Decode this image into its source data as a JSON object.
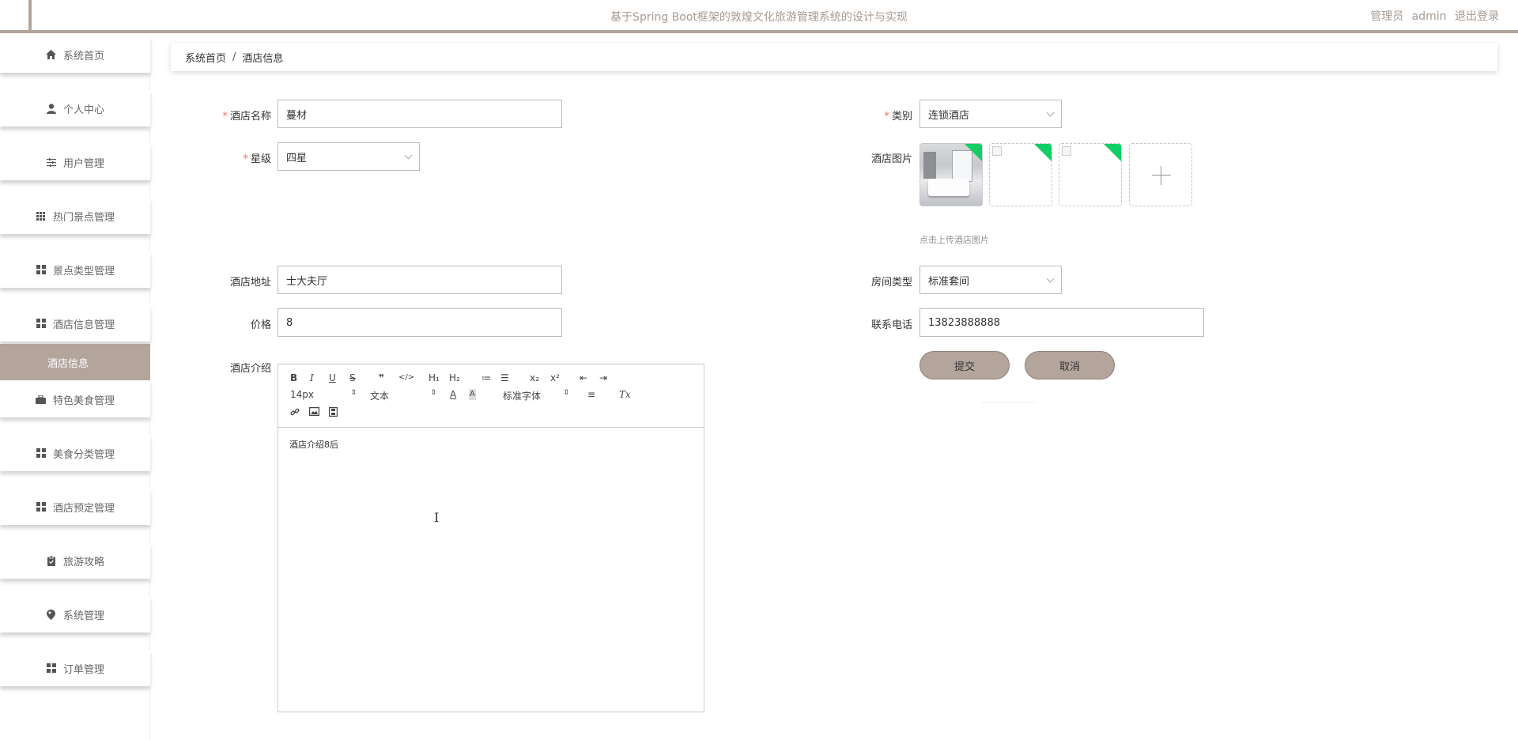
{
  "header": {
    "title": "基于Spring Boot框架的敦煌文化旅游管理系统的设计与实现",
    "role": "管理员",
    "username": "admin",
    "logout_label": "退出登录"
  },
  "sidebar": {
    "items": [
      {
        "label": "系统首页",
        "icon": "home-icon"
      },
      {
        "label": "个人中心",
        "icon": "user-icon"
      },
      {
        "label": "用户管理",
        "icon": "sliders-icon"
      },
      {
        "label": "热门景点管理",
        "icon": "grid-icon"
      },
      {
        "label": "景点类型管理",
        "icon": "apps-icon"
      },
      {
        "label": "酒店信息管理",
        "icon": "apps-icon"
      },
      {
        "label": "酒店信息",
        "active": true
      },
      {
        "label": "特色美食管理",
        "icon": "briefcase-icon"
      },
      {
        "label": "美食分类管理",
        "icon": "apps-icon"
      },
      {
        "label": "酒店预定管理",
        "icon": "apps-icon"
      },
      {
        "label": "旅游攻略",
        "icon": "clipboard-icon"
      },
      {
        "label": "系统管理",
        "icon": "location-icon"
      },
      {
        "label": "订单管理",
        "icon": "apps-icon"
      }
    ],
    "active_color": "#b3a59c"
  },
  "breadcrumb": {
    "home": "系统首页",
    "separator": "/",
    "current": "酒店信息"
  },
  "form": {
    "name": {
      "label": "酒店名称",
      "value": "蔓材"
    },
    "category": {
      "label": "类别",
      "value": "连锁酒店"
    },
    "star": {
      "label": "星级",
      "value": "四星"
    },
    "images": {
      "label": "酒店图片",
      "tip": "点击上传酒店图片"
    },
    "address": {
      "label": "酒店地址",
      "value": "士大夫厅"
    },
    "room_type": {
      "label": "房间类型",
      "value": "标准套间"
    },
    "price": {
      "label": "价格",
      "value": "8"
    },
    "phone": {
      "label": "联系电话",
      "value": "13823888888"
    },
    "intro": {
      "label": "酒店介绍",
      "content": "酒店介绍8后"
    }
  },
  "editor_toolbar": {
    "bold": "B",
    "italic": "I",
    "underline": "U",
    "strike": "S",
    "blockquote": "❞",
    "code": "</>",
    "h1": "H₁",
    "h2": "H₂",
    "ordered_list": "≔",
    "bullet_list": "☰",
    "subscript": "x₂",
    "superscript": "x²",
    "outdent": "⇤",
    "indent": "⇥",
    "size": "14px",
    "header": "文本",
    "font": "标准字体",
    "text_color": "A",
    "background": "A",
    "align": "≡",
    "clean": "Tx"
  },
  "buttons": {
    "submit": "提交",
    "cancel": "取消"
  },
  "accent_color": "#b3a59c",
  "required_color": "#f56c6c"
}
